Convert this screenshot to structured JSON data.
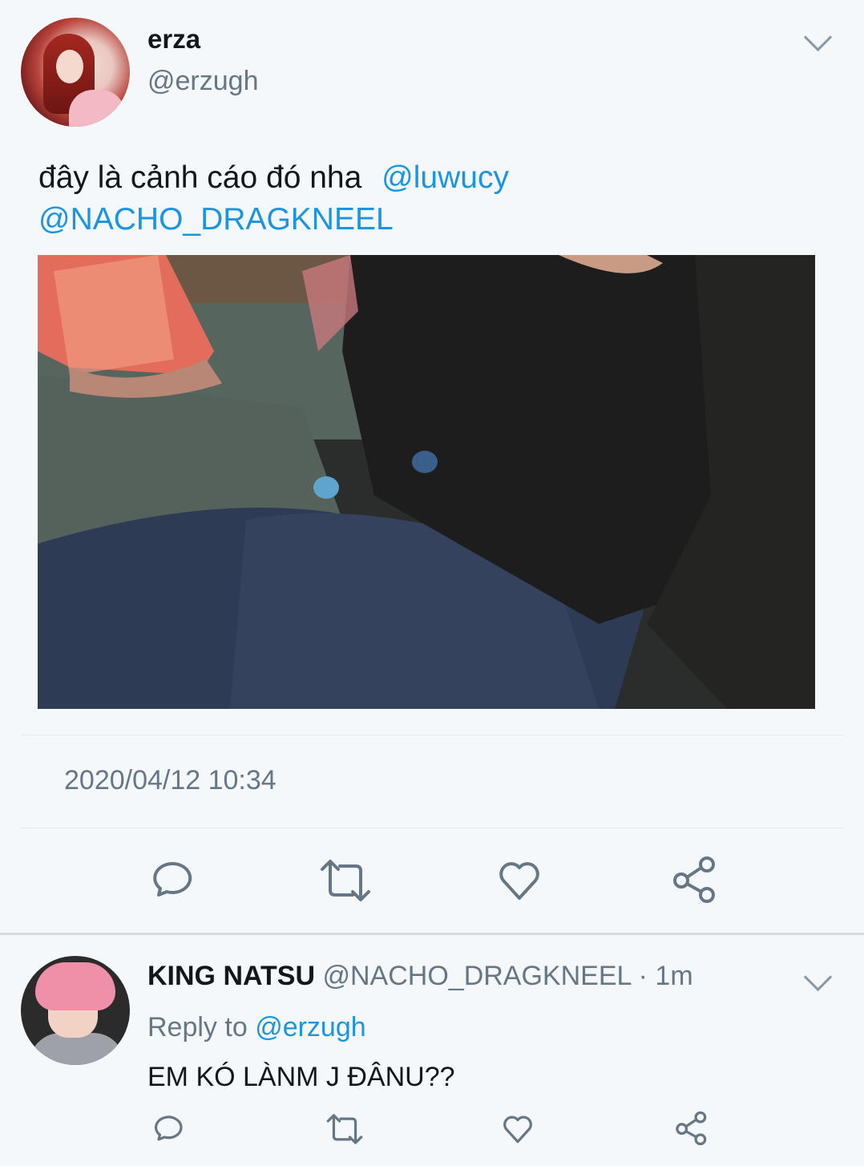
{
  "tweet": {
    "author_name": "erza",
    "author_handle": "@erzugh",
    "text_plain": "đây là cảnh cáo đó nha",
    "mention_1": "@luwucy",
    "mention_2": "@NACHO_DRAGKNEEL",
    "timestamp": "2020/04/12 10:34"
  },
  "actions": [
    "reply-icon",
    "retweet-icon",
    "like-icon",
    "share-icon"
  ],
  "reply": {
    "author_name": "KING NATSU",
    "author_handle": "@NACHO_DRAGKNEEL",
    "separator": "·",
    "time": "1m",
    "reply_to_label": "Reply to",
    "reply_to_handle": "@erzugh",
    "text": "EM KÓ LÀNM J ĐÂNU??"
  },
  "colors": {
    "background": "#f5f8fa",
    "mention": "#1b95e0",
    "secondary": "#657786",
    "icon": "#657786"
  }
}
